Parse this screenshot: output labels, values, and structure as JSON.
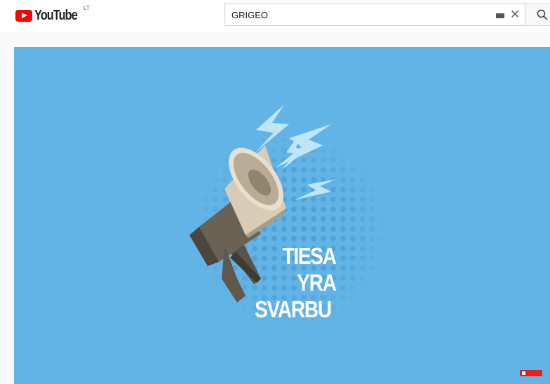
{
  "masthead": {
    "logo_text": "YouTube",
    "country_code": "LT",
    "search_value": "GRIGEO"
  },
  "video": {
    "title_line1": "TIESA",
    "title_line2": "YRA",
    "title_line3": "SVARBU",
    "colors": {
      "background": "#62b4e6",
      "text": "#ffffff"
    }
  },
  "icons": [
    "youtube-logo-icon",
    "keyboard-icon",
    "clear-icon",
    "search-icon",
    "megaphone-icon",
    "lightning-icon",
    "subscribe-badge-icon"
  ]
}
